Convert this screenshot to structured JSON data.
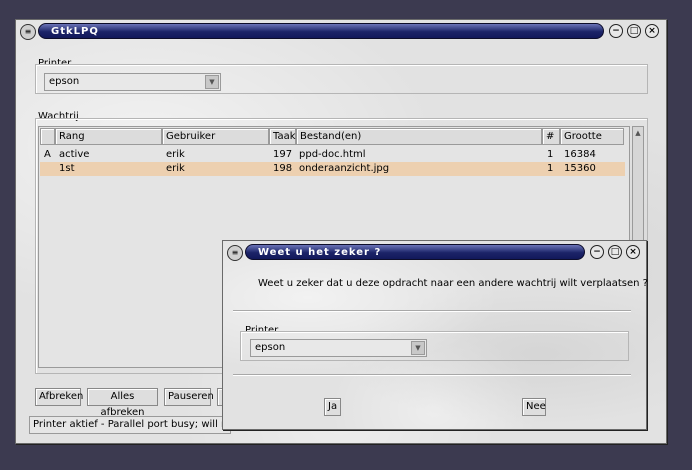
{
  "main_window": {
    "title": "GtkLPQ",
    "printer_group_label": "Printer",
    "printer_value": "epson",
    "queue_label": "Wachtrij",
    "columns": [
      "Rang",
      "Gebruiker",
      "Taak",
      "Bestand(en)",
      "#",
      "Grootte"
    ],
    "jobs": [
      {
        "flag": "A",
        "rank": "active",
        "user": "erik",
        "job": "197",
        "file": "ppd-doc.html",
        "copies": "1",
        "size": "16384"
      },
      {
        "flag": "",
        "rank": "1st",
        "user": "erik",
        "job": "198",
        "file": "onderaanzicht.jpg",
        "copies": "1",
        "size": "15360"
      }
    ],
    "buttons": {
      "cancel": "Afbreken",
      "cancel_all": "Alles afbreken",
      "pause": "Pauseren"
    },
    "status_text": "Printer aktief - Parallel port busy; will retr"
  },
  "dialog": {
    "title": "Weet u het zeker ?",
    "question": "Weet u zeker dat u deze opdracht naar een andere wachtrij wilt verplaatsen ?",
    "printer_label": "Printer",
    "printer_value": "epson",
    "yes_label": "Ja",
    "no_label": "Nee"
  }
}
